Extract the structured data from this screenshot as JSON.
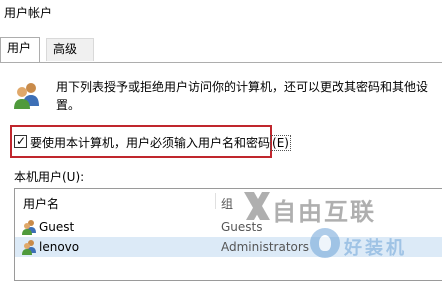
{
  "window": {
    "title": "用户帐户"
  },
  "tabs": [
    {
      "label": "用户"
    },
    {
      "label": "高级"
    }
  ],
  "description": "用下列表授予或拒绝用户访问你的计算机，还可以更改其密码和其他设置。",
  "require_password": {
    "checked": true,
    "label_main": "要使用本计算机，用户必须输入用户名和密码",
    "label_mnemonic": "(E)"
  },
  "local_users": {
    "label": "本机用户(U):"
  },
  "table": {
    "columns": {
      "name": "用户名",
      "group": "组"
    },
    "rows": [
      {
        "name": "Guest",
        "group": "Guests"
      },
      {
        "name": "lenovo",
        "group": "Administrators"
      }
    ],
    "selected_row": 1
  },
  "watermark": {
    "line1": "自由互联",
    "line2": "好装机"
  },
  "colors": {
    "highlight_border": "#c0262d",
    "selection": "#dceaf7"
  }
}
